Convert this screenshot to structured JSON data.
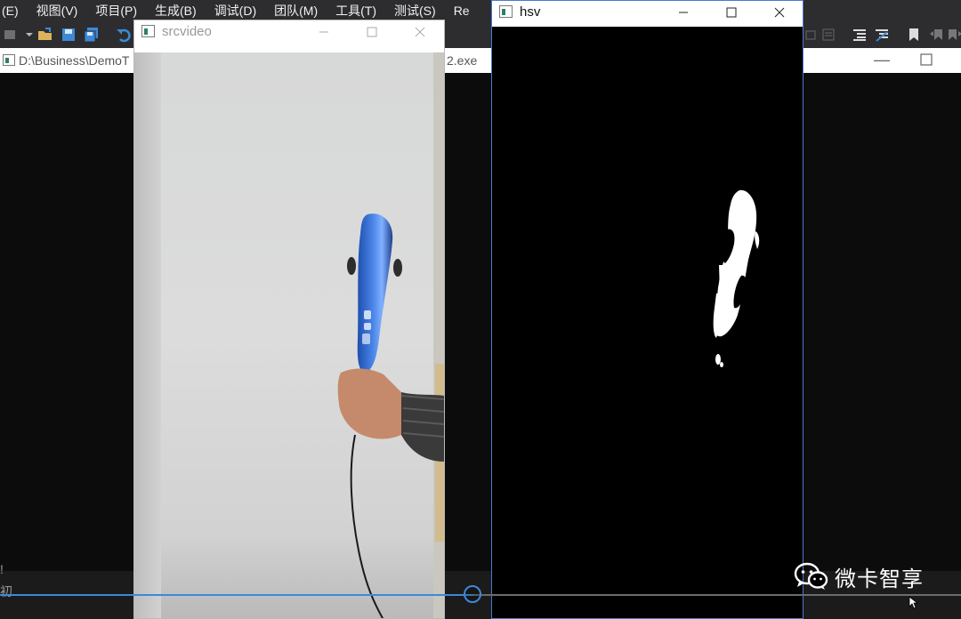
{
  "vs": {
    "menu": [
      "(E)",
      "视图(V)",
      "项目(P)",
      "生成(B)",
      "调试(D)",
      "团队(M)",
      "工具(T)",
      "测试(S)",
      "Re"
    ],
    "console_title_path": "D:\\Business\\DemoT",
    "console_title_tail": "2.exe",
    "side_glyphs": [
      "!",
      "初"
    ]
  },
  "src_window": {
    "title": "srcvideo"
  },
  "hsv_window": {
    "title": "hsv"
  },
  "trackbar": {
    "position": 0.49
  },
  "watermark": {
    "text": "微卡智享",
    "icon": "wechat-icon"
  },
  "colors": {
    "accent_blue": "#3b8ad8",
    "vs_dark": "#2d2d30"
  }
}
